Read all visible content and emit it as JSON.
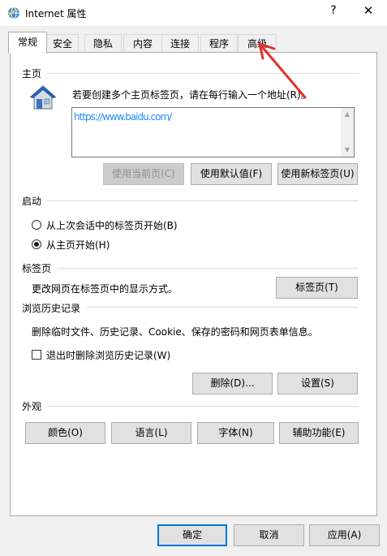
{
  "window": {
    "title": "Internet 属性",
    "help_label": "?",
    "close_label": "✕"
  },
  "tabs": [
    {
      "label": "常规",
      "active": true
    },
    {
      "label": "安全"
    },
    {
      "label": "隐私"
    },
    {
      "label": "内容"
    },
    {
      "label": "连接"
    },
    {
      "label": "程序"
    },
    {
      "label": "高级"
    }
  ],
  "home": {
    "group_label": "主页",
    "description": "若要创建多个主页标签页，请在每行输入一个地址(R)。",
    "url_value": "https://www.baidu.com/",
    "buttons": {
      "use_current": "使用当前页(C)",
      "use_default": "使用默认值(F)",
      "use_new_tab": "使用新标签页(U)"
    }
  },
  "startup": {
    "group_label": "启动",
    "options": [
      {
        "label": "从上次会话中的标签页开始(B)",
        "checked": false
      },
      {
        "label": "从主页开始(H)",
        "checked": true
      }
    ]
  },
  "tabs_section": {
    "group_label": "标签页",
    "description": "更改网页在标签页中的显示方式。",
    "button": "标签页(T)"
  },
  "history": {
    "group_label": "浏览历史记录",
    "description": "删除临时文件、历史记录、Cookie、保存的密码和网页表单信息。",
    "checkbox_label": "退出时删除浏览历史记录(W)",
    "checkbox_checked": false,
    "delete_button": "删除(D)...",
    "settings_button": "设置(S)"
  },
  "appearance": {
    "group_label": "外观",
    "buttons": {
      "colors": "颜色(O)",
      "languages": "语言(L)",
      "fonts": "字体(N)",
      "accessibility": "辅助功能(E)"
    }
  },
  "dialog_buttons": {
    "ok": "确定",
    "cancel": "取消",
    "apply": "应用(A)"
  },
  "colors": {
    "accent": "#0078d7",
    "annotation": "#e0322e"
  }
}
